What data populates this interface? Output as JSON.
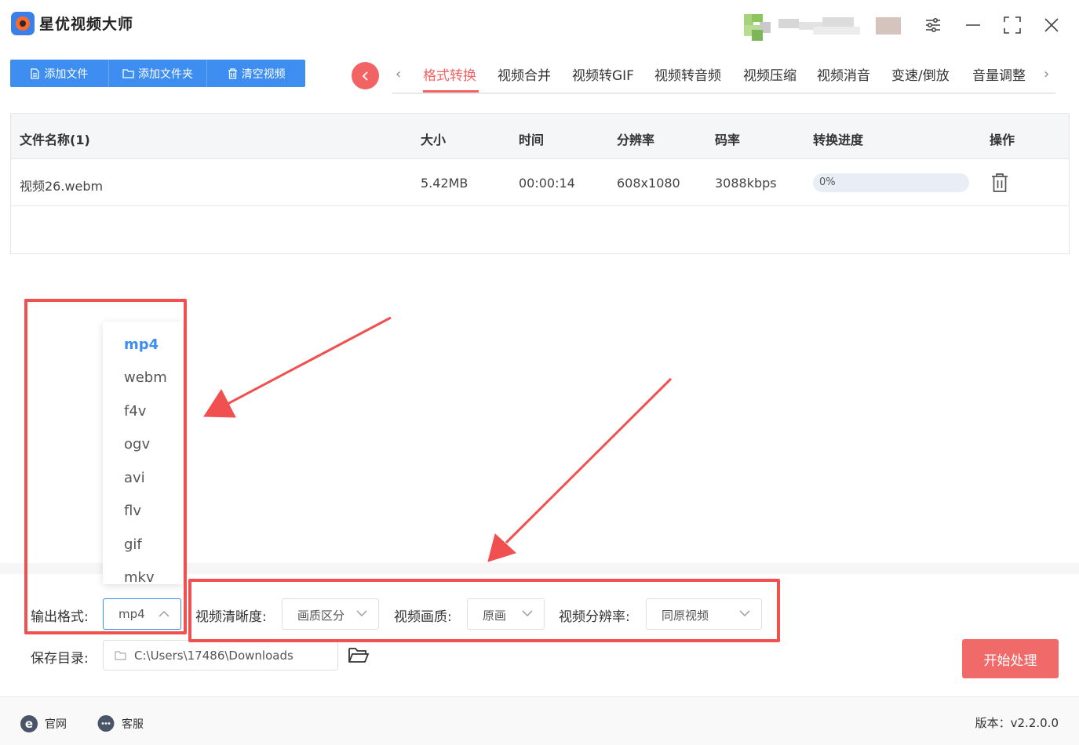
{
  "app": {
    "title": "星优视频大师"
  },
  "toolbar": {
    "add_file": "添加文件",
    "add_folder": "添加文件夹",
    "clear_videos": "清空视频"
  },
  "tabs": [
    {
      "label": "格式转换",
      "active": true
    },
    {
      "label": "视频合并"
    },
    {
      "label": "视频转GIF"
    },
    {
      "label": "视频转音频"
    },
    {
      "label": "视频压缩"
    },
    {
      "label": "视频消音"
    },
    {
      "label": "变速/倒放"
    },
    {
      "label": "音量调整"
    }
  ],
  "table": {
    "headers": {
      "name": "文件名称(1)",
      "size": "大小",
      "duration": "时间",
      "resolution": "分辨率",
      "bitrate": "码率",
      "progress": "转换进度",
      "action": "操作"
    },
    "rows": [
      {
        "name": "视频26.webm",
        "size": "5.42MB",
        "duration": "00:00:14",
        "resolution": "608x1080",
        "bitrate": "3088kbps",
        "progress_text": "0%",
        "progress": 0
      }
    ]
  },
  "format_dropdown": {
    "options": [
      "mp4",
      "webm",
      "f4v",
      "ogv",
      "avi",
      "flv",
      "gif",
      "mkv"
    ],
    "selected": "mp4"
  },
  "settings": {
    "output_format_label": "输出格式:",
    "output_format_value": "mp4",
    "clarity_label": "视频清晰度:",
    "clarity_value": "画质区分",
    "quality_label": "视频画质:",
    "quality_value": "原画",
    "resolution_label": "视频分辨率:",
    "resolution_value": "同原视频",
    "save_dir_label": "保存目录:",
    "save_dir_value": "C:\\Users\\17486\\Downloads"
  },
  "actions": {
    "start": "开始处理"
  },
  "footer": {
    "website": "官网",
    "support": "客服",
    "version": "版本：v2.2.0.0"
  },
  "colors": {
    "accent_blue": "#3d8ef0",
    "accent_red": "#f06464",
    "annotation_red": "#f05050"
  }
}
